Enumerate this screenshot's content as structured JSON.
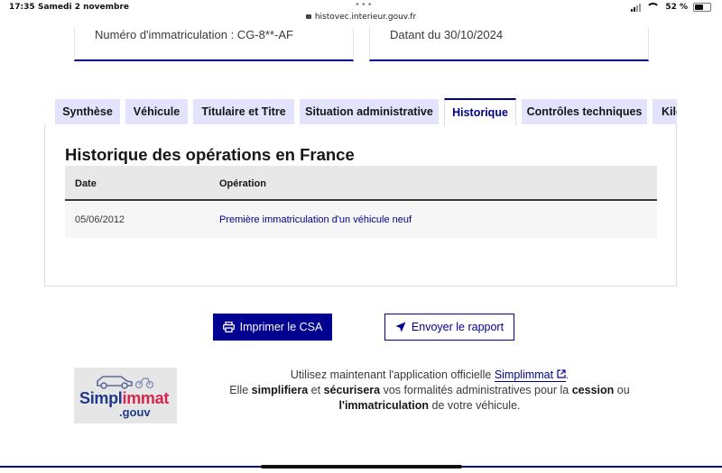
{
  "status_bar": {
    "time": "17:35",
    "date": "Samedi 2 novembre",
    "url": "histovec.interieur.gouv.fr",
    "battery": "52 %",
    "battery_level": 0.52
  },
  "cards": {
    "registration": "Numéro d'immatriculation : CG-8**-AF",
    "date": "Datant du 30/10/2024"
  },
  "tabs": [
    {
      "label": "Synthèse",
      "active": false
    },
    {
      "label": "Véhicule",
      "active": false
    },
    {
      "label": "Titulaire et Titre",
      "active": false
    },
    {
      "label": "Situation administrative",
      "active": false
    },
    {
      "label": "Historique",
      "active": true
    },
    {
      "label": "Contrôles techniques",
      "active": false
    },
    {
      "label": "Kilo",
      "active": false
    }
  ],
  "history": {
    "title": "Historique des opérations en France",
    "columns": [
      "Date",
      "Opération"
    ],
    "rows": [
      {
        "date": "05/06/2012",
        "operation": "Première immatriculation d'un véhicule neuf"
      }
    ]
  },
  "actions": {
    "print_label": "Imprimer le CSA",
    "send_label": "Envoyer le rapport"
  },
  "promo": {
    "logo_text_1": "Simpl",
    "logo_text_2": "immat",
    "logo_text_3": ".gouv",
    "line1_prefix": "Utilisez maintenant l'application officielle",
    "link": "Simplimmat",
    "line1_suffix": ".",
    "line2_a": "Elle",
    "line2_b": "simplifiera",
    "line2_c": "et",
    "line2_d": "sécurisera",
    "line2_e": "vos formalités administratives pour la",
    "line2_f": "cession",
    "line2_g": "ou",
    "line3_a": "l'immatriculation",
    "line3_b": "de votre véhicule."
  },
  "colors": {
    "primary": "#000091",
    "tab_bg": "#e3e3fd",
    "brand_red": "#d6254d"
  }
}
